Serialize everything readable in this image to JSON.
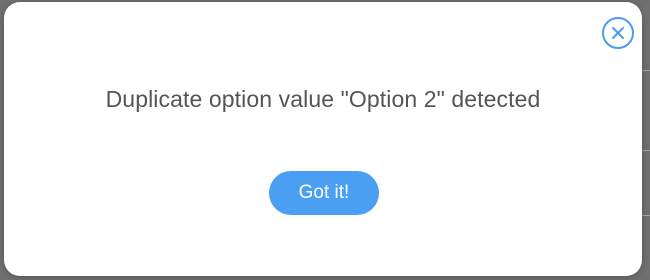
{
  "dialog": {
    "message": "Duplicate option value \"Option 2\" detected",
    "confirm_label": "Got it!",
    "close_icon": "close-icon"
  },
  "colors": {
    "accent": "#4b9ff2",
    "text": "#555555",
    "dialog_bg": "#ffffff",
    "overlay": "#6f6f6f"
  }
}
